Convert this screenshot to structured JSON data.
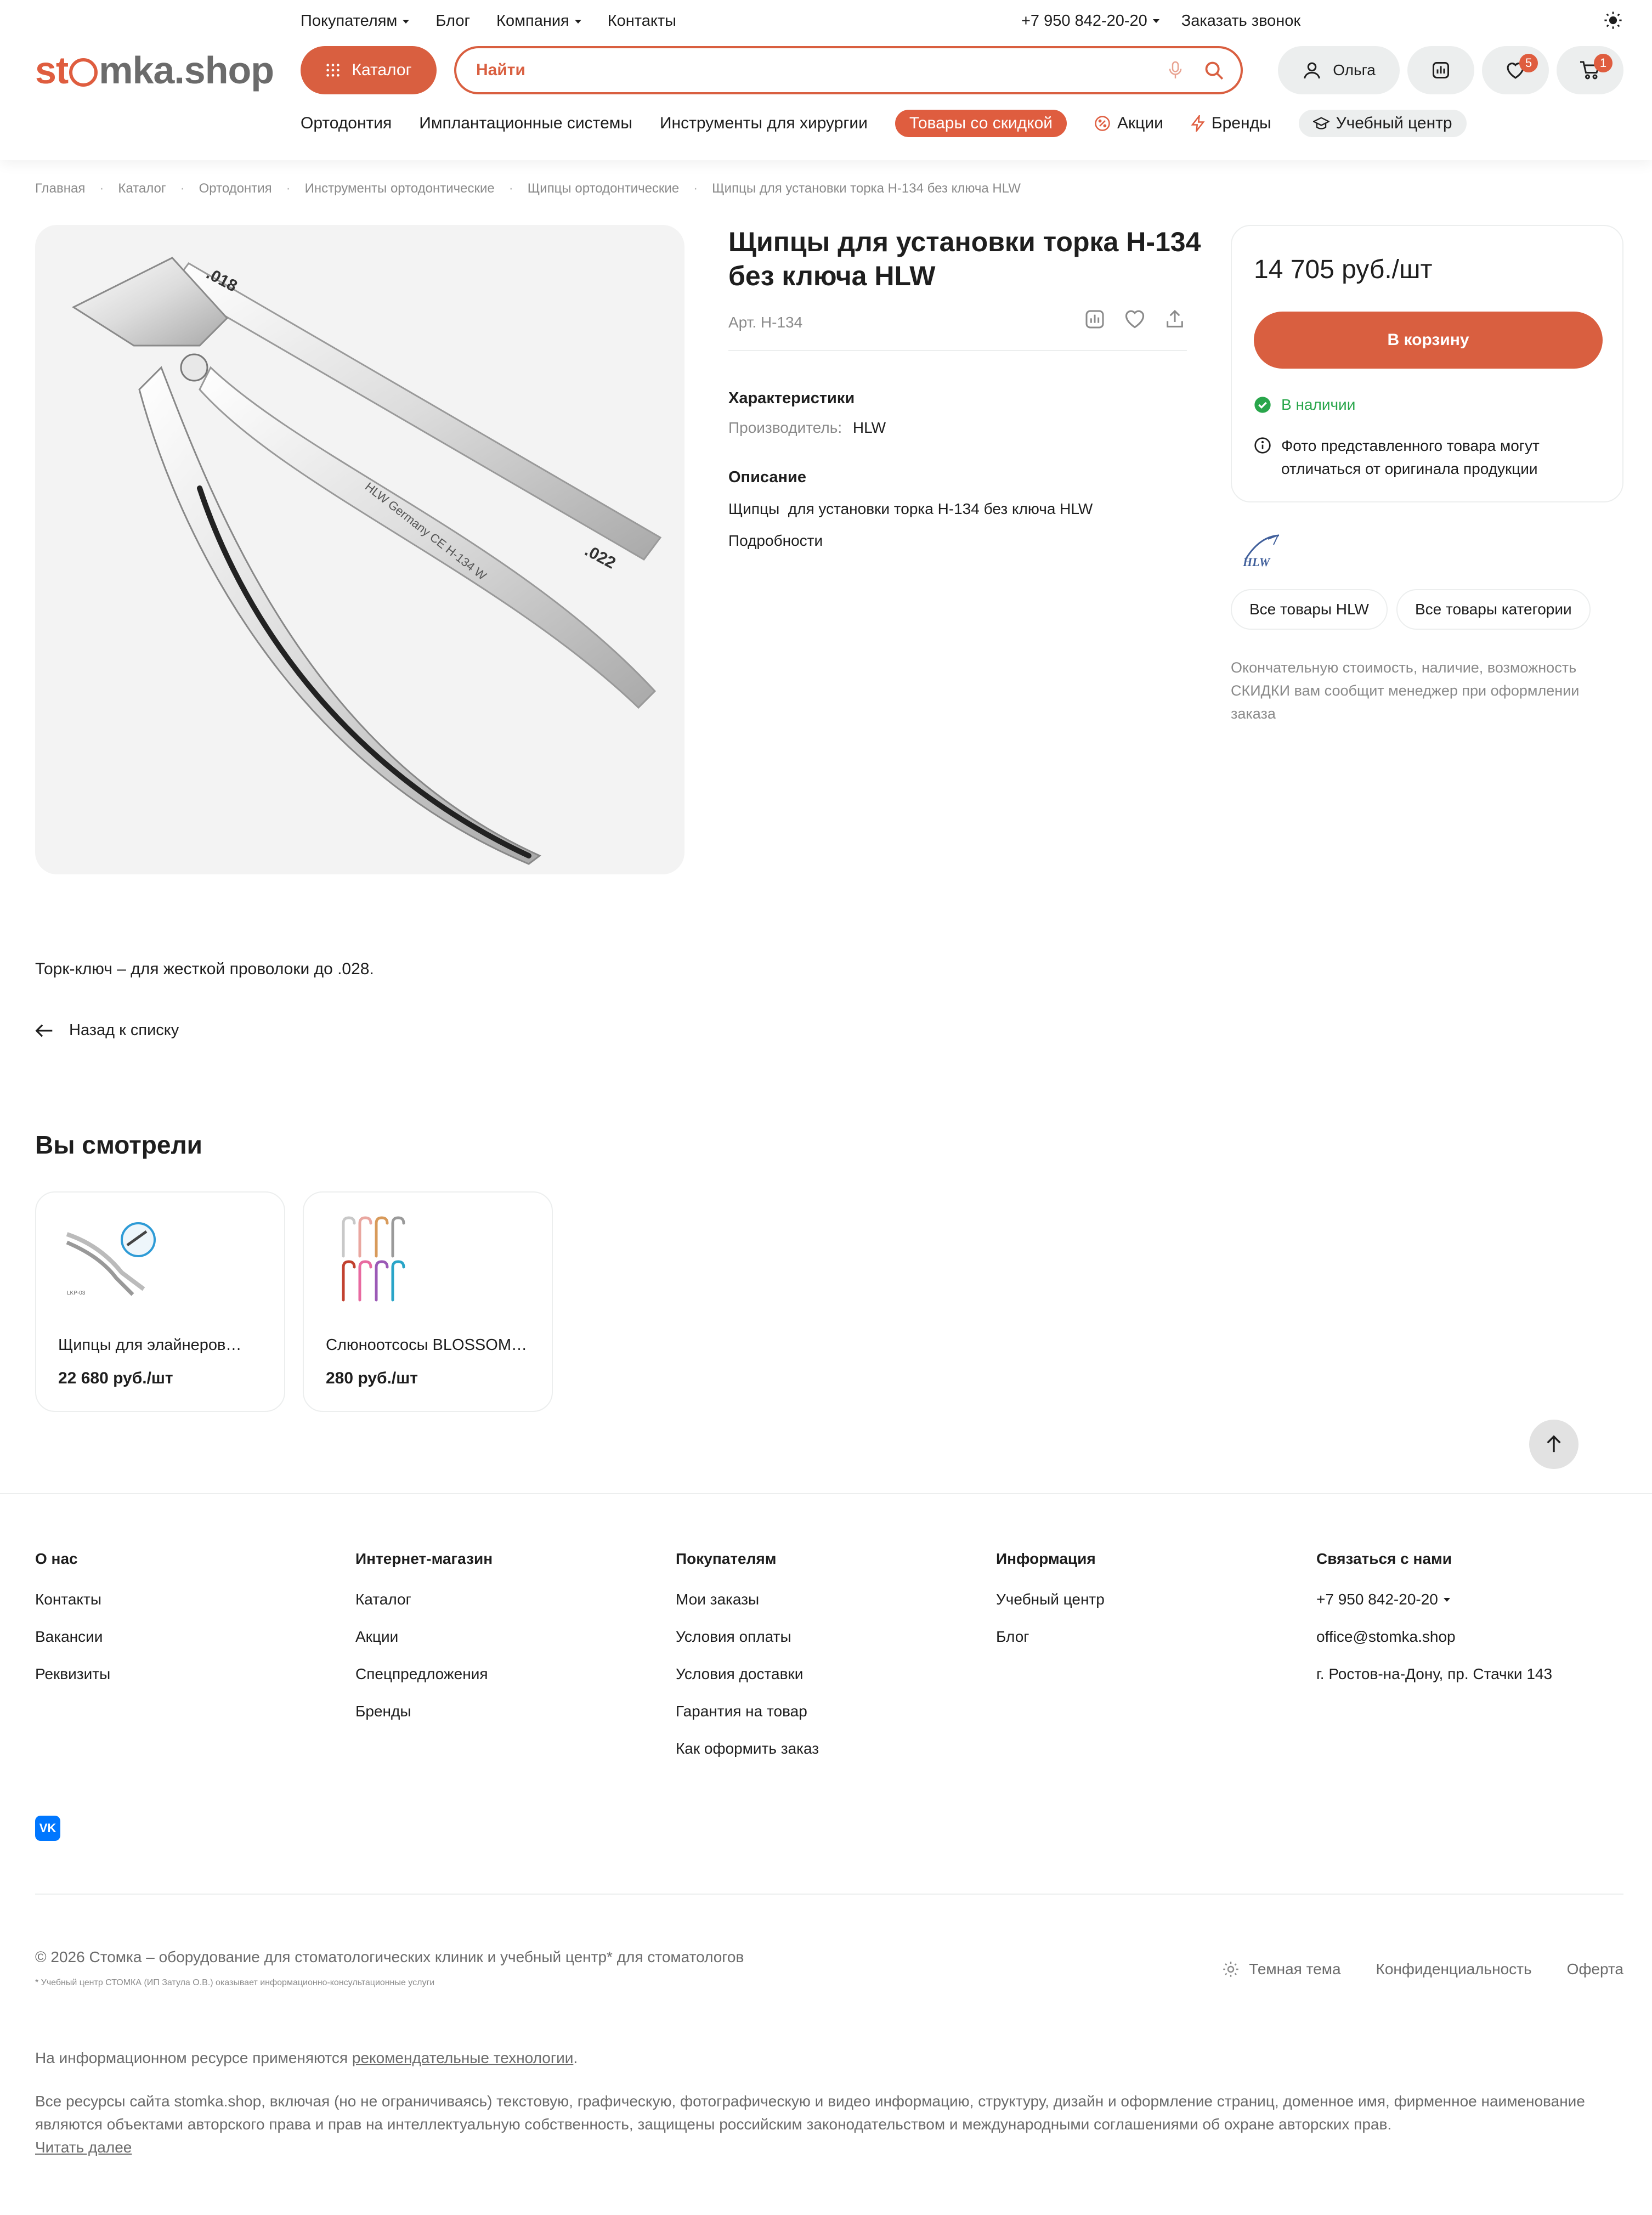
{
  "header": {
    "logo_part1": "st",
    "logo_part2": "mka",
    "logo_part3": ".shop",
    "top_nav": [
      "Покупателям",
      "Блог",
      "Компания",
      "Контакты"
    ],
    "phone": "+7 950 842-20-20",
    "callback": "Заказать звонок",
    "catalog_label": "Каталог",
    "search_placeholder": "Найти",
    "user_name": "Ольга",
    "favorites_count": "5",
    "cart_count": "1",
    "cat_nav": [
      "Ортодонтия",
      "Имплантационные системы",
      "Инструменты для хирургии"
    ],
    "sale_label": "Товары со скидкой",
    "promo_label": "Акции",
    "brands_label": "Бренды",
    "edu_label": "Учебный центр"
  },
  "breadcrumbs": [
    "Главная",
    "Каталог",
    "Ортодонтия",
    "Инструменты ортодонтические",
    "Щипцы ортодонтические",
    "Щипцы для установки торка H-134 без ключа HLW"
  ],
  "product": {
    "title": "Щипцы для установки торка H-134 без ключа HLW",
    "article": "Арт. H-134",
    "photo_mark_top": ".018",
    "photo_mark_bottom": ".022",
    "photo_engraving": "HLW Germany CE H-134 W",
    "specs_heading": "Характеристики",
    "manufacturer_label": "Производитель:",
    "manufacturer_value": "HLW",
    "desc_heading": "Описание",
    "desc_text": "Щипцы  для установки торка H-134 без ключа HLW",
    "details_link": "Подробности",
    "full_description": "Торк-ключ – для жесткой проволоки до .028."
  },
  "purchase": {
    "price": "14 705 руб./шт",
    "cart_button": "В корзину",
    "stock": "В наличии",
    "photo_note": "Фото представленного товара могут отличаться от оригинала продукции",
    "brand_logo": "HLW",
    "all_brand": "Все товары HLW",
    "all_category": "Все товары категории",
    "manager_note": "Окончательную стоимость, наличие, возможность СКИДКИ вам сообщит менеджер при оформлении заказа"
  },
  "back_label": "Назад к списку",
  "viewed": {
    "heading": "Вы смотрели",
    "items": [
      {
        "name": "Щипцы для элайнеров…",
        "price": "22 680 руб./шт",
        "img_code": "LKP-03"
      },
      {
        "name": "Слюноотсосы BLOSSOM…",
        "price": "280 руб./шт"
      }
    ]
  },
  "footer": {
    "cols": [
      {
        "title": "О нас",
        "links": [
          "Контакты",
          "Вакансии",
          "Реквизиты"
        ]
      },
      {
        "title": "Интернет-магазин",
        "links": [
          "Каталог",
          "Акции",
          "Спецпредложения",
          "Бренды"
        ]
      },
      {
        "title": "Покупателям",
        "links": [
          "Мои заказы",
          "Условия оплаты",
          "Условия доставки",
          "Гарантия на товар",
          "Как оформить заказ"
        ]
      },
      {
        "title": "Информация",
        "links": [
          "Учебный центр",
          "Блог"
        ]
      },
      {
        "title": "Связаться с нами",
        "links": [
          "+7 950 842-20-20",
          "office@stomka.shop",
          "г. Ростов-на-Дону, пр. Стачки 143"
        ]
      }
    ],
    "vk": "VK",
    "copyright": "© 2026 Стомка – оборудование для стоматологических клиник и учебный центр* для стоматологов",
    "copyright_note": "* Учебный центр СТОМКА (ИП Затула О.В.) оказывает информационно-консультационные услуги",
    "dark_theme": "Темная тема",
    "privacy": "Конфиденциальность",
    "offer": "Оферта",
    "legal1_a": "На информационном ресурсе применяются ",
    "legal1_link": "рекомендательные технологии",
    "legal1_b": ".",
    "legal2": "Все ресурсы сайта stomka.shop, включая (но не ограничиваясь) текстовую, графическую, фотографическую и видео информацию, структуру, дизайн и оформление страниц, доменное имя, фирменное наименование являются объектами авторского права и прав на интеллектуальную собственность, защищены российским законодательством и международными соглашениями об охране авторских прав.",
    "read_more": "Читать далее"
  },
  "colors": {
    "accent": "#d95f40",
    "success": "#29a64b",
    "gray_bg": "#eceeee"
  }
}
